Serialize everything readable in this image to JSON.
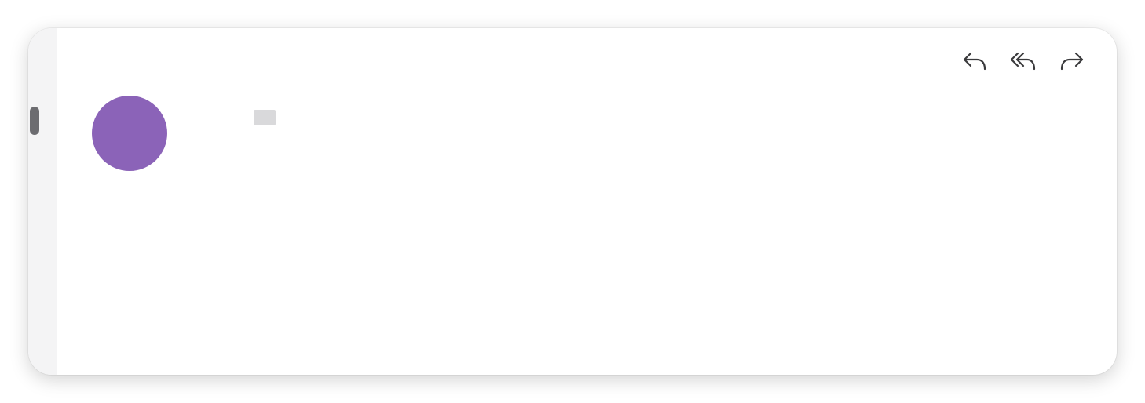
{
  "email": {
    "subject": "",
    "from": {
      "display": "",
      "avatar_initials": ""
    },
    "to": {
      "label": "",
      "value": ""
    },
    "time": "",
    "body": ""
  },
  "actions": {
    "reply_icon": "reply-icon",
    "reply_all_icon": "reply-all-icon",
    "forward_icon": "forward-icon"
  },
  "colors": {
    "avatar_bg": "#8b63b8",
    "accent": "#8b63b8"
  }
}
